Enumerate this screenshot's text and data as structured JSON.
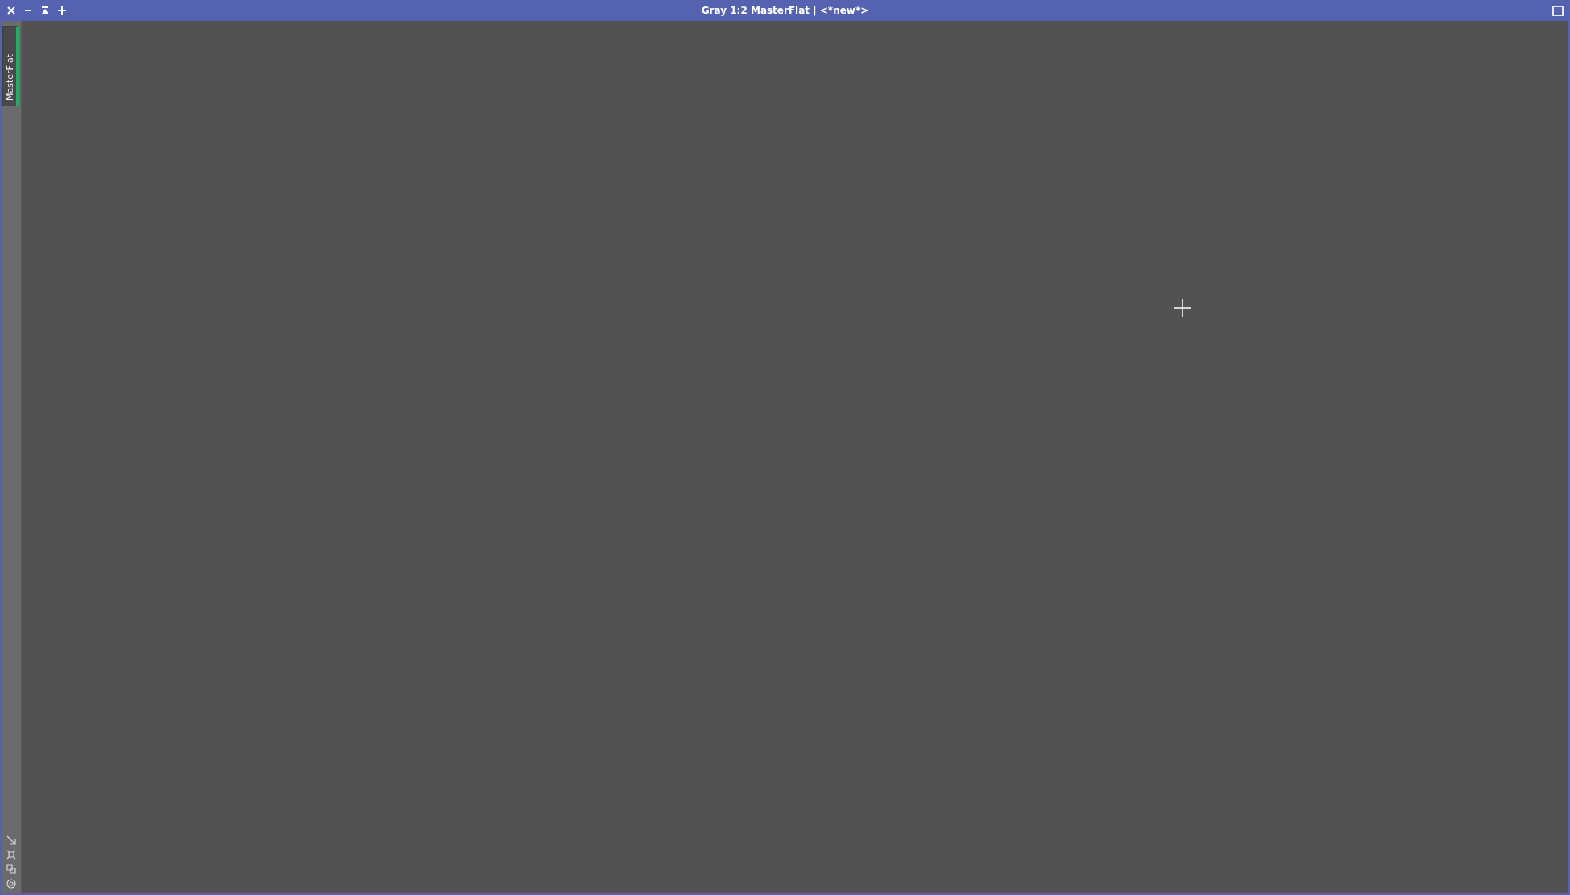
{
  "window": {
    "title": "Gray 1:2 MasterFlat | <*new*>"
  },
  "tabs": [
    {
      "label": "MasterFlat",
      "selected": true
    }
  ]
}
